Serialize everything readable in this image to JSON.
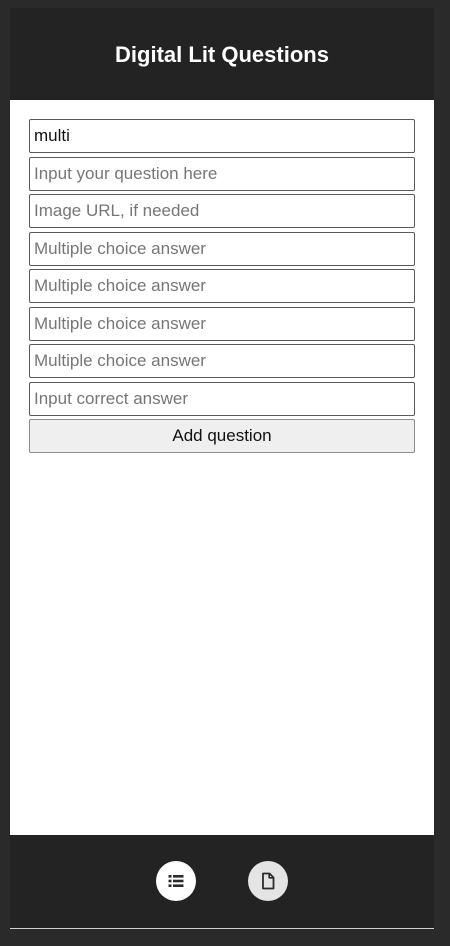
{
  "header": {
    "title": "Digital Lit Questions"
  },
  "form": {
    "question_type": {
      "value": "multi",
      "placeholder": ""
    },
    "question": {
      "value": "",
      "placeholder": "Input your question here"
    },
    "image_url": {
      "value": "",
      "placeholder": "Image URL, if needed"
    },
    "choices": [
      {
        "value": "",
        "placeholder": "Multiple choice answer"
      },
      {
        "value": "",
        "placeholder": "Multiple choice answer"
      },
      {
        "value": "",
        "placeholder": "Multiple choice answer"
      },
      {
        "value": "",
        "placeholder": "Multiple choice answer"
      }
    ],
    "correct_answer": {
      "value": "",
      "placeholder": "Input correct answer"
    },
    "add_button_label": "Add question"
  },
  "footer": {
    "nav": [
      {
        "icon": "list-icon"
      },
      {
        "icon": "document-icon"
      }
    ]
  },
  "colors": {
    "background": "#232323",
    "content": "#ffffff",
    "button": "#efefef"
  }
}
